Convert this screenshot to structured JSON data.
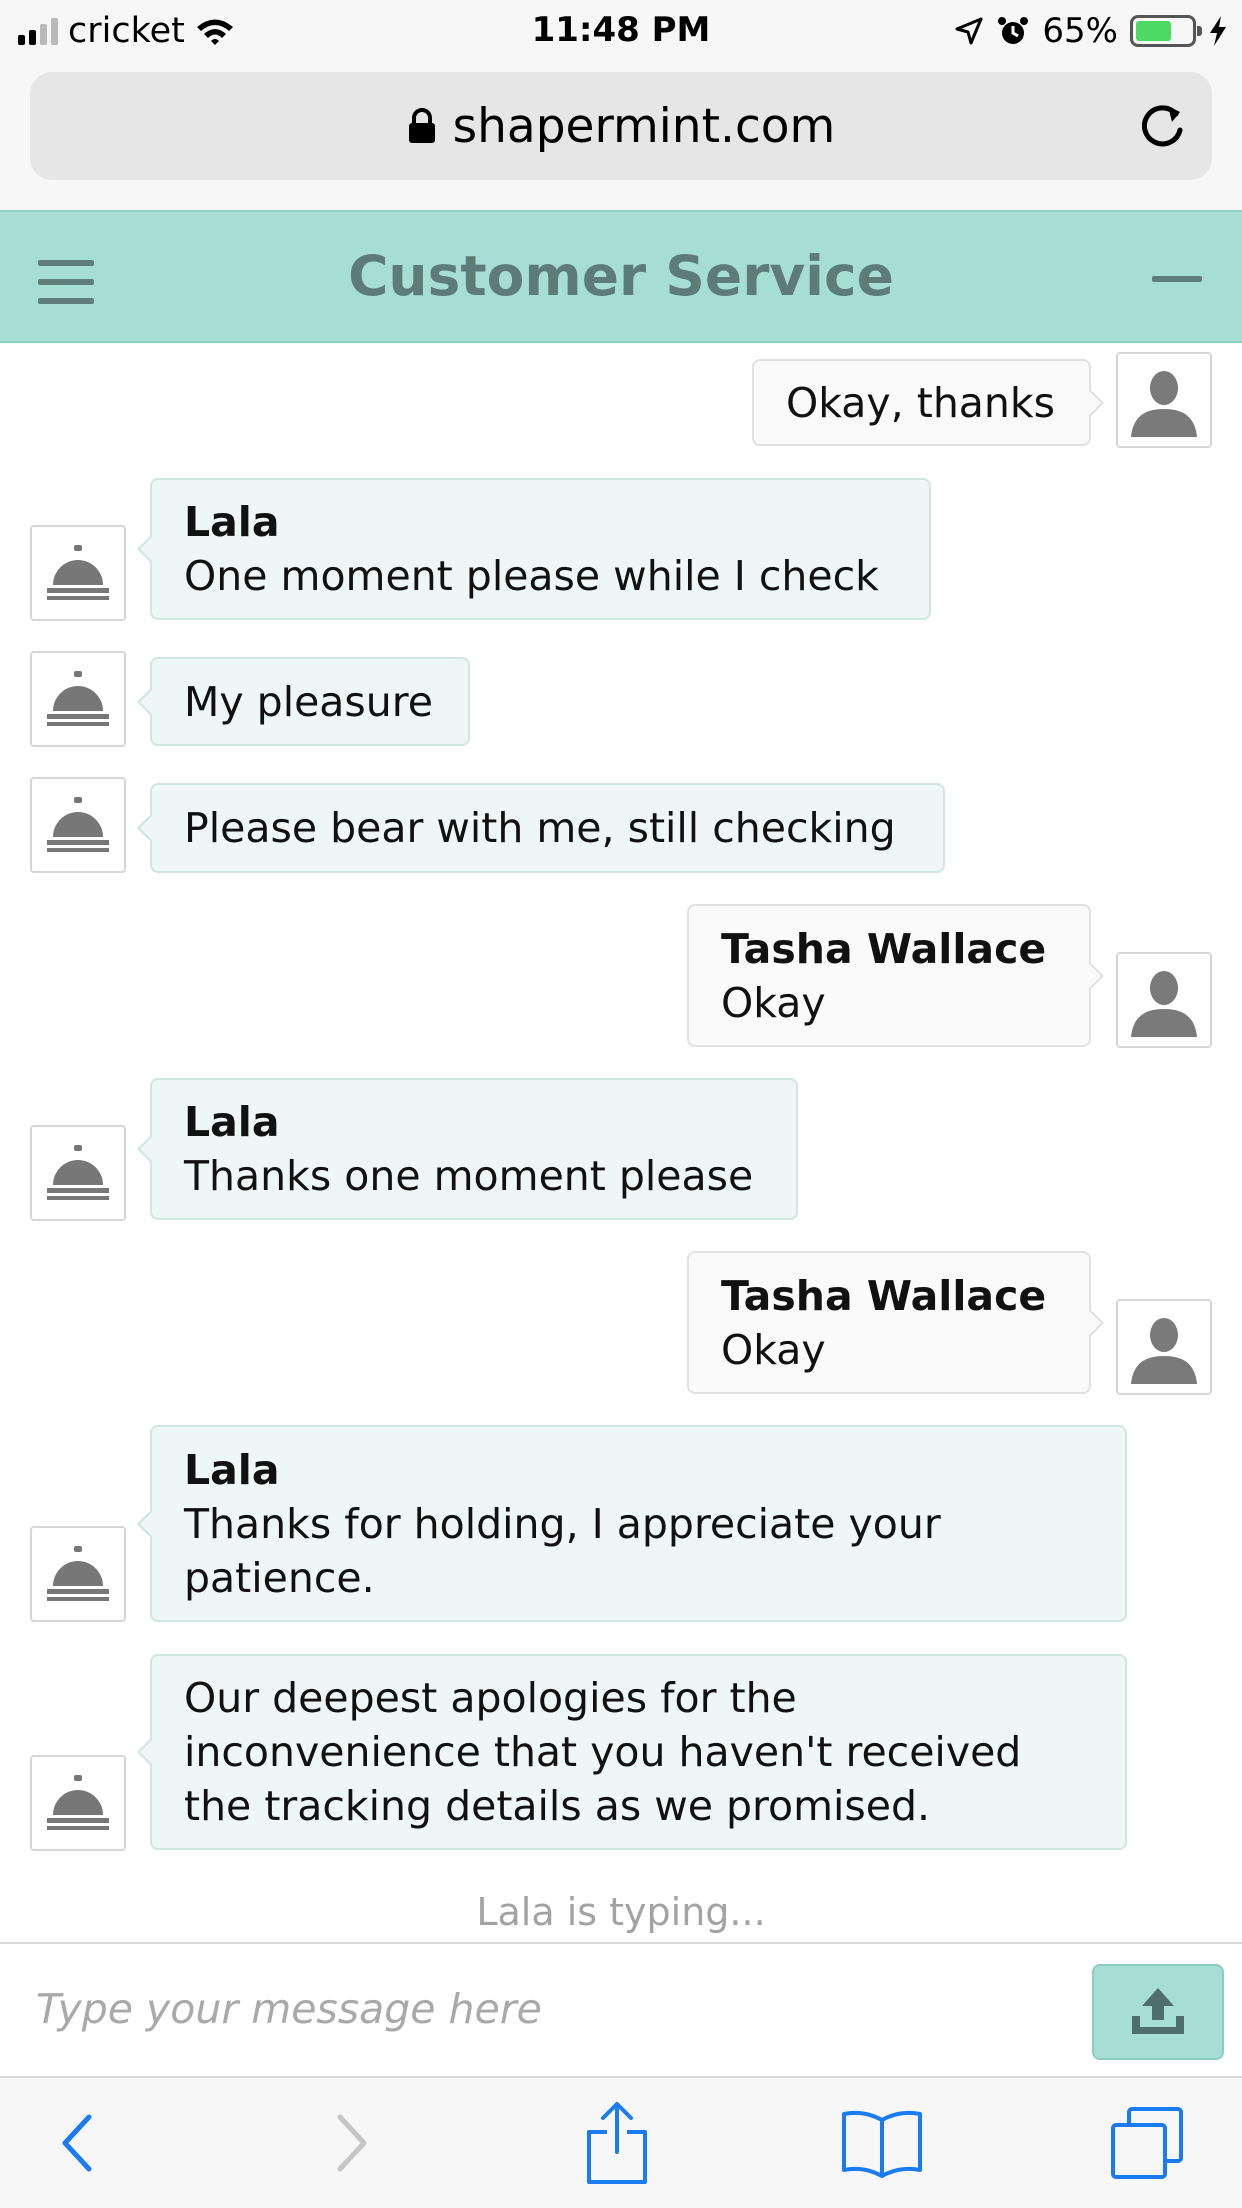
{
  "status_bar": {
    "carrier": "cricket",
    "time": "11:48 PM",
    "battery_percent": "65%",
    "battery_level": 0.65
  },
  "browser": {
    "url": "shapermint.com"
  },
  "header": {
    "title": "Customer Service"
  },
  "messages": [
    {
      "side": "user",
      "sender": "",
      "text": "Okay, thanks"
    },
    {
      "side": "agent",
      "sender": "Lala",
      "text": "One moment please while I check"
    },
    {
      "side": "agent",
      "sender": "",
      "text": "My pleasure"
    },
    {
      "side": "agent",
      "sender": "",
      "text": "Please bear with me, still checking"
    },
    {
      "side": "user",
      "sender": "Tasha Wallace",
      "text": "Okay"
    },
    {
      "side": "agent",
      "sender": "Lala",
      "text": "Thanks one moment please"
    },
    {
      "side": "user",
      "sender": "Tasha Wallace",
      "text": "Okay"
    },
    {
      "side": "agent",
      "sender": "Lala",
      "text": "Thanks for holding, I appreciate your patience."
    },
    {
      "side": "agent",
      "sender": "",
      "text": "Our deepest apologies for the inconvenience that you haven't received the tracking details as we promised."
    }
  ],
  "typing_indicator": "Lala is typing...",
  "composer": {
    "placeholder": "Type your message here"
  },
  "icons": {
    "agent_avatar": "service-bell-icon",
    "user_avatar": "person-silhouette-icon",
    "send": "upload-icon"
  },
  "colors": {
    "header_bg": "#a6ded6",
    "header_text": "#5d7c77",
    "agent_bubble": "#eef7f5",
    "ios_blue": "#1a7cf0"
  }
}
